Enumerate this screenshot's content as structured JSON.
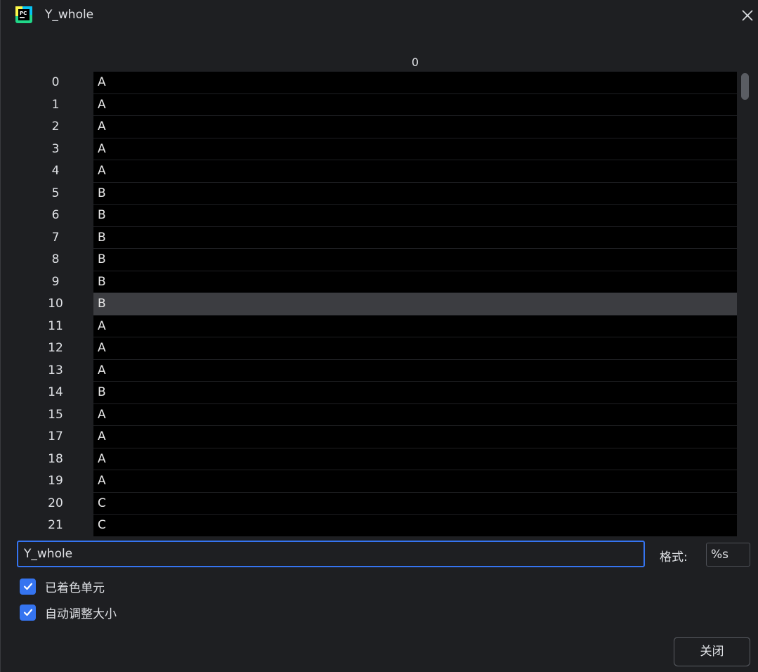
{
  "window": {
    "title": "Y_whole",
    "app_icon": "pycharm-logo-icon",
    "close_icon": "close-icon"
  },
  "table": {
    "column_header": "0",
    "rows": [
      {
        "index": "0",
        "value": "A"
      },
      {
        "index": "1",
        "value": "A"
      },
      {
        "index": "2",
        "value": "A"
      },
      {
        "index": "3",
        "value": "A"
      },
      {
        "index": "4",
        "value": "A"
      },
      {
        "index": "5",
        "value": "B"
      },
      {
        "index": "6",
        "value": "B"
      },
      {
        "index": "7",
        "value": "B"
      },
      {
        "index": "8",
        "value": "B"
      },
      {
        "index": "9",
        "value": "B"
      },
      {
        "index": "10",
        "value": "B",
        "selected": true
      },
      {
        "index": "11",
        "value": "A"
      },
      {
        "index": "12",
        "value": "A"
      },
      {
        "index": "13",
        "value": "A"
      },
      {
        "index": "14",
        "value": "B"
      },
      {
        "index": "15",
        "value": "A"
      },
      {
        "index": "17",
        "value": "A"
      },
      {
        "index": "18",
        "value": "A"
      },
      {
        "index": "19",
        "value": "A"
      },
      {
        "index": "20",
        "value": "C"
      },
      {
        "index": "21",
        "value": "C"
      }
    ]
  },
  "footer": {
    "expression_value": "Y_whole",
    "format_label": "格式:",
    "format_value": "%s",
    "colored_cells_label": "已着色单元",
    "colored_cells_checked": true,
    "auto_resize_label": "自动调整大小",
    "auto_resize_checked": true,
    "close_button_label": "关闭"
  },
  "colors": {
    "accent": "#3574f0",
    "background": "#1e1f22",
    "cell_background": "#000000",
    "selected_cell": "#3c3d41"
  }
}
